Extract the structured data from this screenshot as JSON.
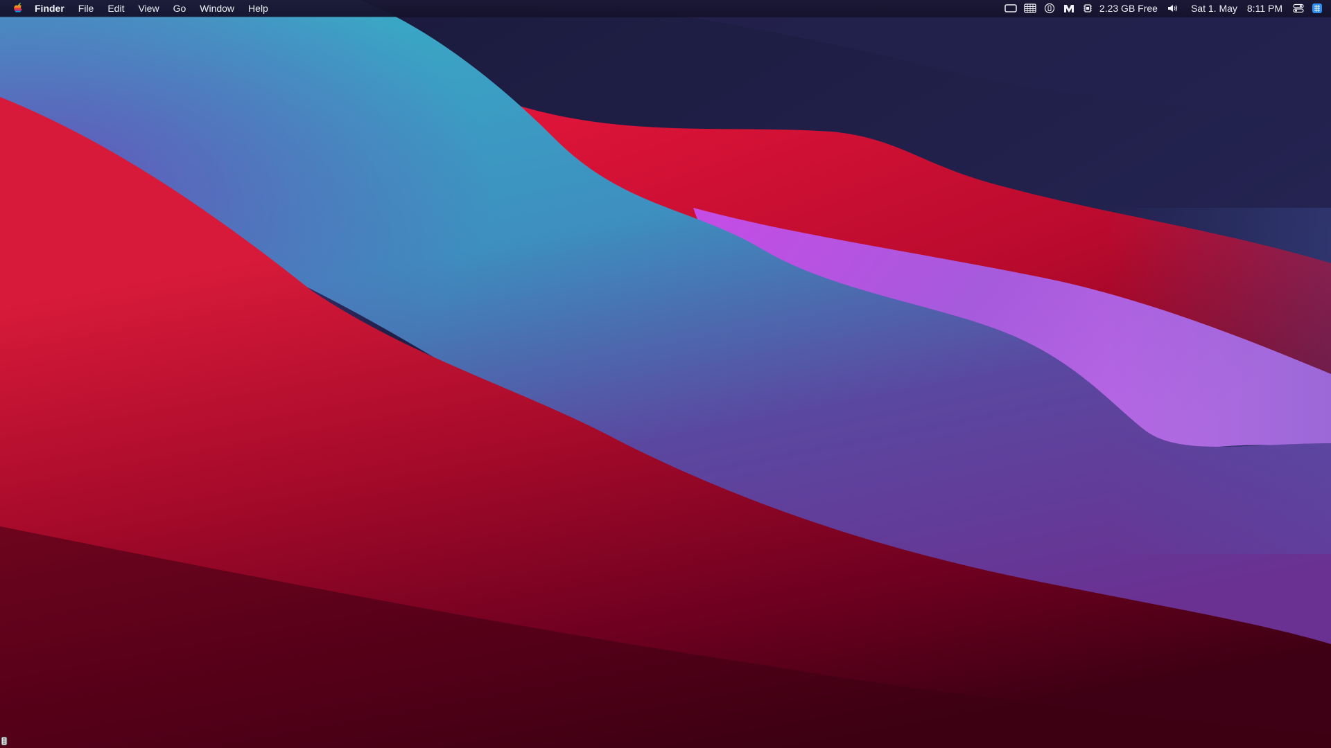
{
  "menubar": {
    "apple_menu_icon": "apple-logo-icon",
    "app_name": "Finder",
    "menus": [
      "File",
      "Edit",
      "View",
      "Go",
      "Window",
      "Help"
    ],
    "status": {
      "icons": [
        "screen-mirror-icon",
        "keyboard-grid-icon",
        "circle-button-icon",
        "m-badge-icon"
      ],
      "memory_icon": "memory-chip-icon",
      "memory_text": "2.23 GB Free",
      "volume_icon": "volume-icon",
      "date": "Sat 1. May",
      "time": "8:11 PM",
      "control_center_icon": "control-center-icon",
      "blue_app_icon": "blue-app-icon"
    }
  },
  "wallpaper": {
    "name": "macOS Big Sur",
    "colors": {
      "sky": "#1e1c45",
      "teal": "#35a3c4",
      "crimson": "#c4102f",
      "magenta": "#b04ae0",
      "deep_red": "#4a0018"
    }
  },
  "corner_icon": "dock-handle-icon"
}
